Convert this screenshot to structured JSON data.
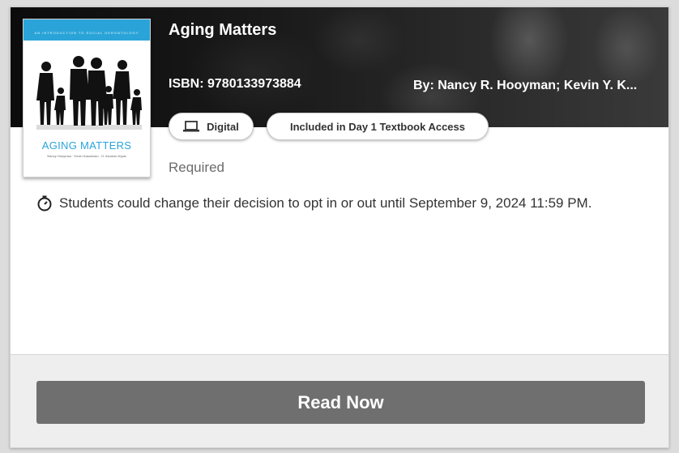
{
  "book": {
    "title": "Aging Matters",
    "isbn": "ISBN: 9780133973884",
    "authors": "By: Nancy R. Hooyman; Kevin Y. K...",
    "status": "Required"
  },
  "cover": {
    "title": "AGING MATTERS",
    "band_text": "AN INTRODUCTION TO SOCIAL GERONTOLOGY",
    "authors": "Nancy Hooyman · Kevin Kawamoto · H. Asuman Kiyak",
    "accent_color": "#2aa4d8",
    "image": "family-silhouette"
  },
  "chips": {
    "digital": {
      "label": "Digital",
      "icon": "laptop-icon"
    },
    "access": {
      "label": "Included in Day 1 Textbook Access"
    }
  },
  "notice": {
    "icon": "timer-icon",
    "text": "Students could change their decision to opt in or out until September 9, 2024 11:59 PM."
  },
  "actions": {
    "read_now": "Read Now",
    "button_color": "#6f6f6f"
  }
}
